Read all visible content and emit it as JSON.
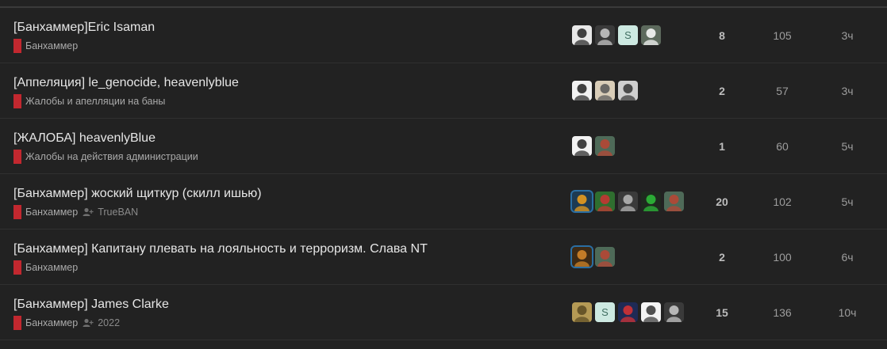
{
  "topics": [
    {
      "title": "[Банхаммер]Eric Isaman",
      "category": "Банхаммер",
      "tag": "",
      "replies": "8",
      "views": "105",
      "activity": "3ч",
      "posters": [
        {
          "icon": "avatar-dark-meme",
          "bg": "#e8e8e8",
          "fg": "#222",
          "glyph": ""
        },
        {
          "icon": "avatar-grey-sketch",
          "bg": "#3a3a3a",
          "fg": "#ccc",
          "glyph": ""
        },
        {
          "icon": "avatar-letter-s",
          "bg": "#cde9e1",
          "fg": "#3f6d60",
          "glyph": "S"
        },
        {
          "icon": "avatar-green-figure",
          "bg": "#5d6a5d",
          "fg": "#fff",
          "glyph": ""
        }
      ]
    },
    {
      "title": "[Аппеляция] le_genocide, heavenlyblue",
      "category": "Жалобы и апелляции на баны",
      "tag": "",
      "replies": "2",
      "views": "57",
      "activity": "3ч",
      "posters": [
        {
          "icon": "avatar-troll-face",
          "bg": "#f2f2f2",
          "fg": "#222",
          "glyph": ""
        },
        {
          "icon": "avatar-beige-character",
          "bg": "#d9cdb8",
          "fg": "#555",
          "glyph": ""
        },
        {
          "icon": "avatar-mixed-character",
          "bg": "#cfcfcf",
          "fg": "#333",
          "glyph": ""
        }
      ]
    },
    {
      "title": "[ЖАЛОБА] heavenlyBlue",
      "category": "Жалобы на действия администрации",
      "tag": "",
      "replies": "1",
      "views": "60",
      "activity": "5ч",
      "posters": [
        {
          "icon": "avatar-troll-face",
          "bg": "#f2f2f2",
          "fg": "#222",
          "glyph": ""
        },
        {
          "icon": "avatar-red-beret",
          "bg": "#4e6a58",
          "fg": "#b43",
          "glyph": ""
        }
      ]
    },
    {
      "title": "[Банхаммер] жоский щиткур (скилл ишью)",
      "category": "Банхаммер",
      "tag": "TrueBAN",
      "replies": "20",
      "views": "102",
      "activity": "5ч",
      "posters": [
        {
          "icon": "avatar-sunglasses-emoji",
          "bg": "#1d3a52",
          "fg": "#f3a21b",
          "glyph": "",
          "hl": true
        },
        {
          "icon": "avatar-green-sprite",
          "bg": "#2f6e2f",
          "fg": "#c33",
          "glyph": ""
        },
        {
          "icon": "avatar-dark-character",
          "bg": "#3b3b3b",
          "fg": "#bbb",
          "glyph": ""
        },
        {
          "icon": "avatar-green-silhouette",
          "bg": "#1f2a1f",
          "fg": "#2ec23a",
          "glyph": ""
        },
        {
          "icon": "avatar-red-beret",
          "bg": "#4e6a58",
          "fg": "#b43",
          "glyph": ""
        }
      ]
    },
    {
      "title": "[Банхаммер] Капитану плевать на лояльность и терроризм. Слава NT",
      "category": "Банхаммер",
      "tag": "",
      "replies": "2",
      "views": "100",
      "activity": "6ч",
      "posters": [
        {
          "icon": "avatar-lion",
          "bg": "#3d2a15",
          "fg": "#d98a2a",
          "glyph": "",
          "hl": true
        },
        {
          "icon": "avatar-red-beret",
          "bg": "#4e6a58",
          "fg": "#b43",
          "glyph": ""
        }
      ]
    },
    {
      "title": "[Банхаммер] James Clarke",
      "category": "Банхаммер",
      "tag": "2022",
      "replies": "15",
      "views": "136",
      "activity": "10ч",
      "posters": [
        {
          "icon": "avatar-tan-camo",
          "bg": "#b59a55",
          "fg": "#5a4a22",
          "glyph": ""
        },
        {
          "icon": "avatar-letter-s",
          "bg": "#cde9e1",
          "fg": "#3f6d60",
          "glyph": "S"
        },
        {
          "icon": "avatar-flag-character",
          "bg": "#1e2a55",
          "fg": "#d33",
          "glyph": ""
        },
        {
          "icon": "avatar-white-sketch",
          "bg": "#f4f4f4",
          "fg": "#333",
          "glyph": ""
        },
        {
          "icon": "avatar-grey-sketch",
          "bg": "#3a3a3a",
          "fg": "#ccc",
          "glyph": ""
        }
      ]
    }
  ]
}
